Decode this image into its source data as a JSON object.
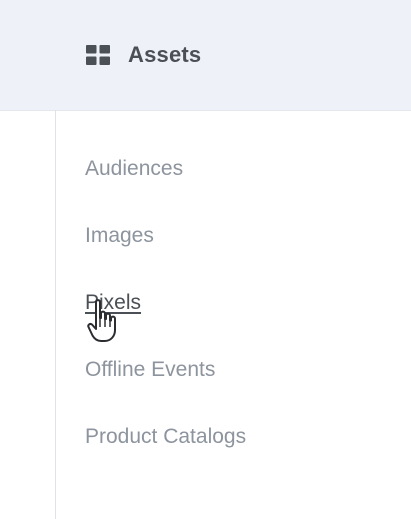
{
  "header": {
    "title": "Assets",
    "icon": "grid-icon"
  },
  "nav": {
    "items": [
      {
        "label": "Audiences"
      },
      {
        "label": "Images"
      },
      {
        "label": "Pixels",
        "active": true
      },
      {
        "label": "Offline Events"
      },
      {
        "label": "Product Catalogs"
      }
    ]
  },
  "cursor": {
    "icon": "hand-pointer-icon"
  },
  "colors": {
    "header_bg": "#eef1f7",
    "title_text": "#4b4f56",
    "nav_text": "#8d949e",
    "active_text": "#4b4f56"
  }
}
